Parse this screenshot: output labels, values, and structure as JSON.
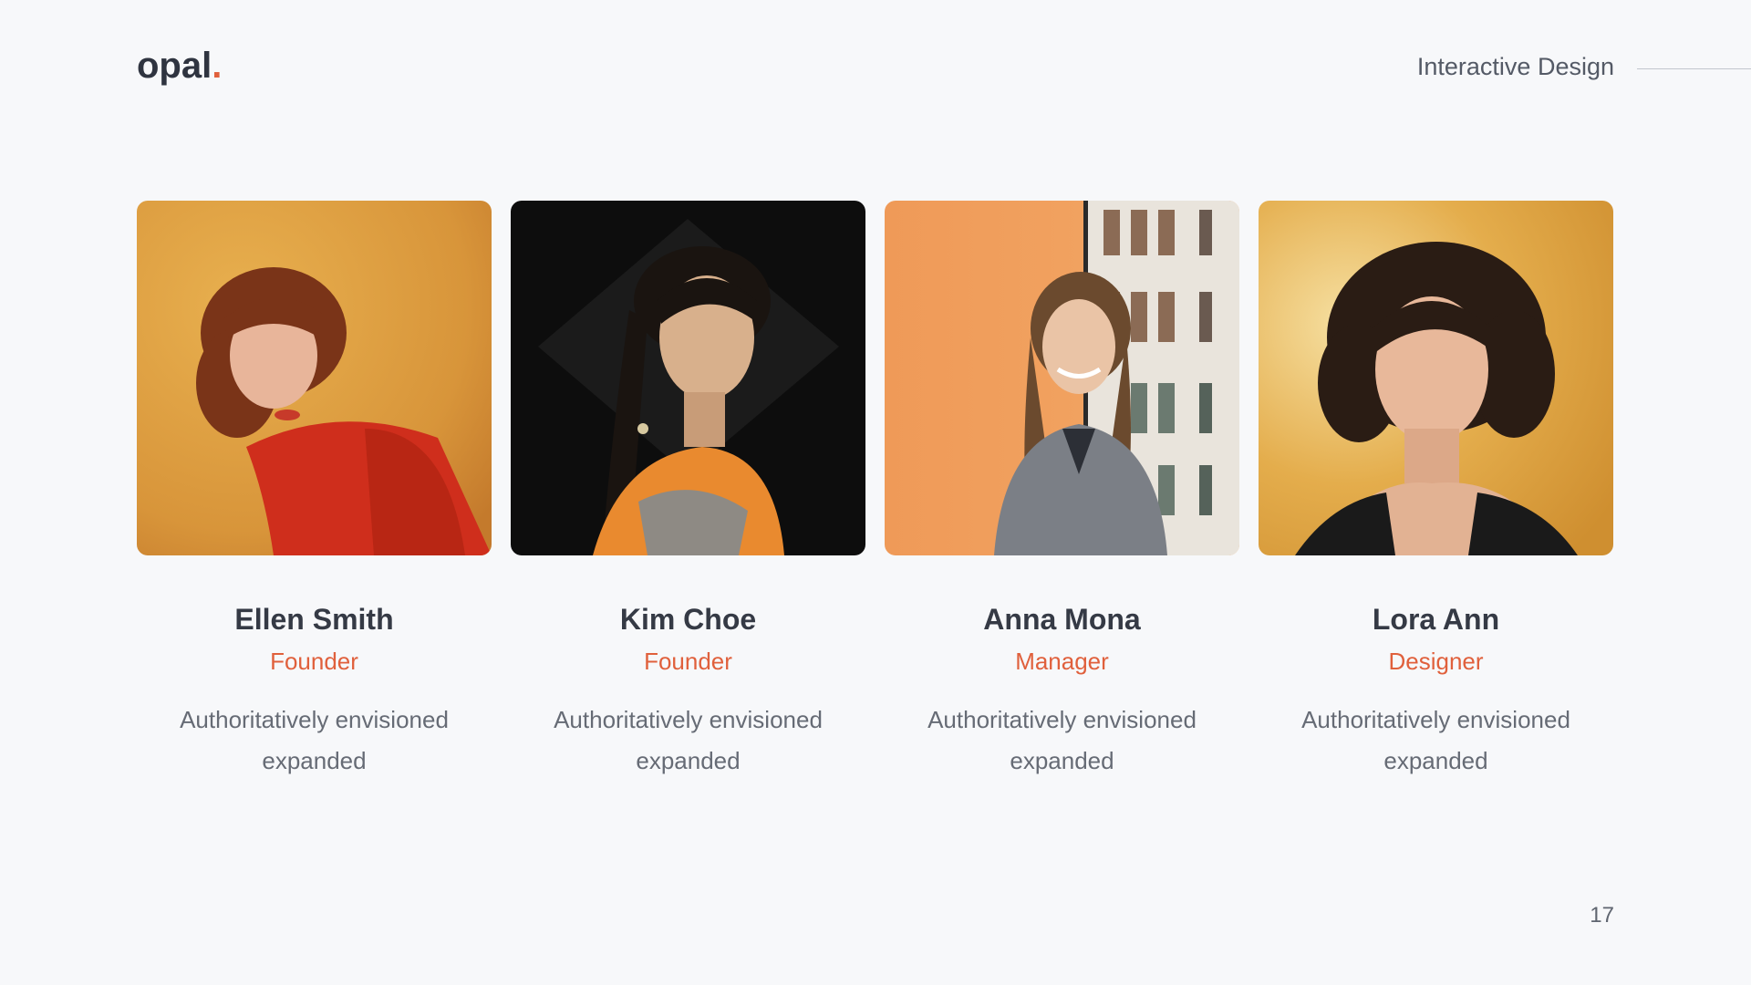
{
  "brand": {
    "name": "opal",
    "dot": "."
  },
  "header": {
    "section_title": "Interactive Design"
  },
  "team": [
    {
      "name": "Ellen Smith",
      "role": "Founder",
      "description": "Authoritatively envisioned expanded",
      "photo_icon": "portrait-photo"
    },
    {
      "name": "Kim Choe",
      "role": "Founder",
      "description": "Authoritatively envisioned expanded",
      "photo_icon": "portrait-photo"
    },
    {
      "name": "Anna Mona",
      "role": "Manager",
      "description": "Authoritatively envisioned expanded",
      "photo_icon": "portrait-photo"
    },
    {
      "name": "Lora Ann",
      "role": "Designer",
      "description": "Authoritatively envisioned expanded",
      "photo_icon": "portrait-photo"
    }
  ],
  "page_number": "17",
  "colors": {
    "accent": "#e0603c",
    "text_dark": "#353a45",
    "background": "#f7f8fa"
  }
}
